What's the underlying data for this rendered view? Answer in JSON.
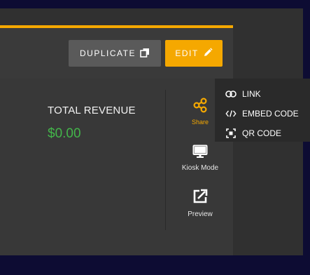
{
  "toolbar": {
    "duplicate_label": "DUPLICATE",
    "edit_label": "EDIT"
  },
  "stats": {
    "revenue_label": "TOTAL REVENUE",
    "revenue_value": "$0.00"
  },
  "side_tools": [
    {
      "label": "Share",
      "icon": "share-icon",
      "active": true
    },
    {
      "label": "Kiosk Mode",
      "icon": "monitor-icon"
    },
    {
      "label": "Preview",
      "icon": "external-link-icon"
    }
  ],
  "share_menu": [
    {
      "label": "LINK",
      "icon": "link-icon"
    },
    {
      "label": "EMBED CODE",
      "icon": "code-icon"
    },
    {
      "label": "QR CODE",
      "icon": "qr-code-icon"
    }
  ],
  "colors": {
    "accent": "#f5a800",
    "revenue": "#43b54a",
    "page_bg": "#0d0c33"
  }
}
